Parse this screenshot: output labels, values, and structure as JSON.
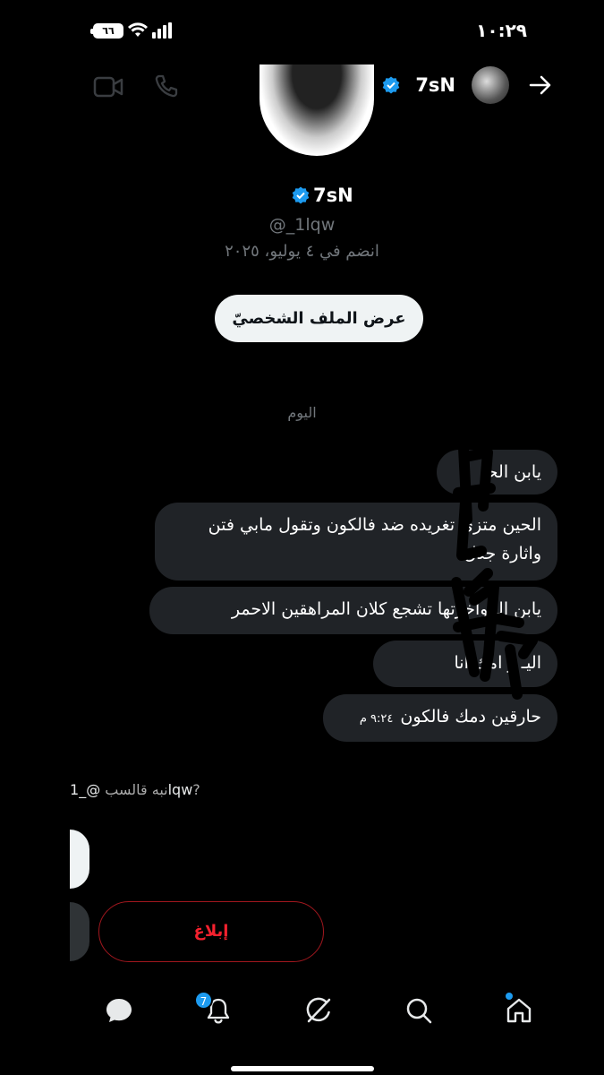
{
  "status_bar": {
    "time": "١٠:٢٩",
    "battery": "٦٦"
  },
  "header": {
    "name": "7sN"
  },
  "profile": {
    "name": "7sN",
    "handle": "@_1lqw",
    "joined": "انضم في ٤ يوليو، ٢٠٢٥",
    "view_profile_label": "عرض الملف الشخصيّ"
  },
  "date_separator": "اليوم",
  "messages": [
    {
      "text": "يابن الحـ"
    },
    {
      "text": "الحين متزى تغريده ضد فالكون وتقول مابي فتن واثارة جدل"
    },
    {
      "text": "يابن الـ واخرتها تشجع كلان المراهقين الاحمر"
    },
    {
      "text": "اليـ و امك انا"
    },
    {
      "text": "حارقين دمك فالكون",
      "time": "٩:٢٤ م"
    }
  ],
  "mention": {
    "handle": "@_1lqw",
    "prefix": "نبه قالسب",
    "suffix": "?"
  },
  "actions": {
    "report_label": "إبلاغ"
  },
  "bottom_nav": {
    "notifications_badge": "7",
    "items": [
      "messages-icon",
      "bell-icon",
      "grok-icon",
      "search-icon",
      "home-icon"
    ]
  },
  "colors": {
    "accent": "#1d9bf0",
    "bubble": "#202327",
    "report": "#f4212e",
    "muted": "#71767b"
  }
}
